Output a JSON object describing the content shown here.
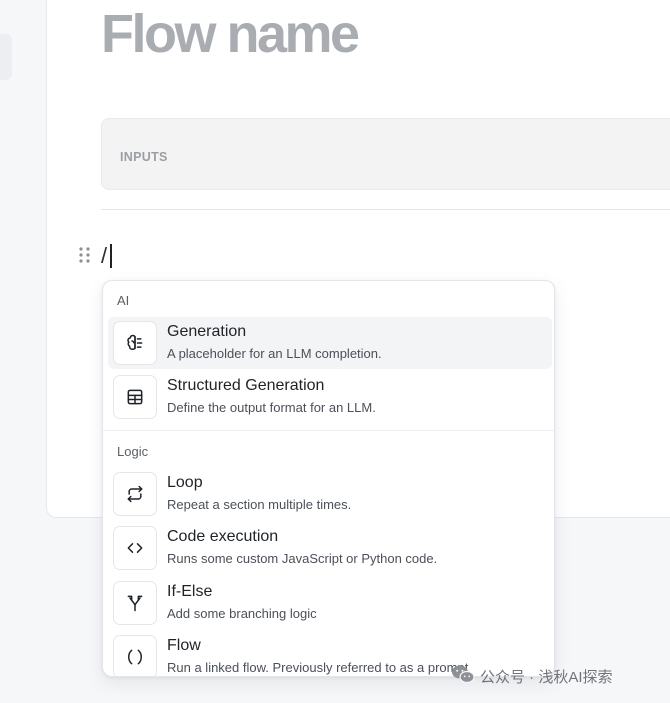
{
  "editor": {
    "title": "Flow name",
    "inputs_label": "INPUTS",
    "typed_text": "/"
  },
  "menu": {
    "sections": [
      {
        "label": "AI",
        "items": [
          {
            "title": "Generation",
            "description": "A placeholder for an LLM completion.",
            "icon": "brain-icon",
            "active": true
          },
          {
            "title": "Structured Generation",
            "description": "Define the output format for an LLM.",
            "icon": "table-icon",
            "active": false
          }
        ]
      },
      {
        "label": "Logic",
        "items": [
          {
            "title": "Loop",
            "description": "Repeat a section multiple times.",
            "icon": "repeat-icon"
          },
          {
            "title": "Code execution",
            "description": "Runs some custom JavaScript or Python code.",
            "icon": "code-icon"
          },
          {
            "title": "If-Else",
            "description": "Add some branching logic",
            "icon": "split-icon"
          },
          {
            "title": "Flow",
            "description": "Run a linked flow. Previously referred to as a prompt",
            "icon": "parentheses-icon"
          }
        ]
      }
    ]
  },
  "watermark": {
    "text": "公众号 · 浅秋AI探索",
    "icon": "wechat-icon"
  },
  "colors": {
    "title_gray": "#a9adb2",
    "active_row": "#f3f4f6",
    "border": "#e3e5e8"
  }
}
